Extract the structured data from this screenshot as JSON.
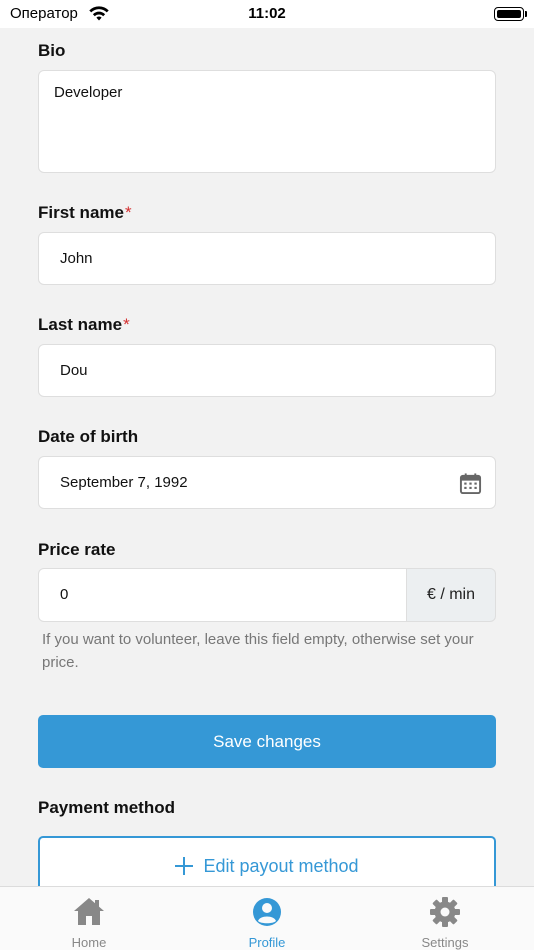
{
  "status_bar": {
    "carrier": "Оператор",
    "time": "11:02"
  },
  "form": {
    "bio": {
      "label": "Bio",
      "value": "Developer"
    },
    "first_name": {
      "label": "First name",
      "required_mark": "*",
      "value": "John"
    },
    "last_name": {
      "label": "Last name",
      "required_mark": "*",
      "value": "Dou"
    },
    "date_of_birth": {
      "label": "Date of birth",
      "value": "September 7, 1992",
      "icon": "calendar-icon"
    },
    "price_rate": {
      "label": "Price rate",
      "value": "0",
      "unit": "€ / min",
      "hint": "If you want to volunteer, leave this field empty, otherwise set your price."
    }
  },
  "save_button": {
    "label": "Save changes"
  },
  "payment": {
    "label": "Payment method",
    "edit_button": {
      "label": "Edit payout method",
      "icon": "plus-icon"
    }
  },
  "tab_bar": {
    "active": "Profile",
    "items": [
      {
        "label": "Home",
        "icon": "home-icon"
      },
      {
        "label": "Profile",
        "icon": "user-circle-icon"
      },
      {
        "label": "Settings",
        "icon": "gear-icon"
      }
    ]
  },
  "colors": {
    "accent": "#3598d6",
    "required": "#d32f2f",
    "background": "#f2f2f2",
    "inactive_tab": "#888888"
  }
}
